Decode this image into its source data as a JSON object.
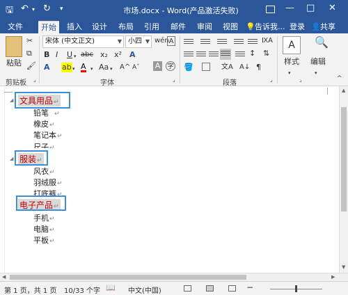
{
  "titlebar": {
    "save_icon": "save-icon",
    "undo_icon": "undo-icon",
    "redo_icon": "redo-icon",
    "title": "市场.docx - Word(产品激活失败)",
    "ribbon_display_icon": "ribbon-display-icon",
    "minimize": "—",
    "maximize": "□",
    "close": "✕"
  },
  "tabs": [
    "文件",
    "开始",
    "插入",
    "设计",
    "布局",
    "引用",
    "邮件",
    "审阅",
    "视图"
  ],
  "tell_me": "告诉我...",
  "signin": "登录",
  "share": "共享",
  "ribbon": {
    "clipboard": {
      "paste": "粘贴",
      "group": "剪贴板"
    },
    "font": {
      "name": "宋体 (中文正文)",
      "size": "小四",
      "bold": "B",
      "italic": "I",
      "underline": "U",
      "strike": "abc",
      "subscript": "x₂",
      "superscript": "x²",
      "case": "Aa",
      "group": "字体"
    },
    "paragraph": {
      "group": "段落"
    },
    "styles": {
      "label": "样式"
    },
    "editing": {
      "label": "编辑"
    }
  },
  "document": {
    "groups": [
      {
        "title": "文具用品",
        "items": [
          "铅笔",
          "橡皮",
          "笔记本",
          "尺子"
        ]
      },
      {
        "title": "服装",
        "items": [
          "风衣",
          "羽绒服",
          "打底裤"
        ]
      },
      {
        "title": "电子产品",
        "items": [
          "手机",
          "电脑",
          "平板"
        ]
      }
    ]
  },
  "status": {
    "page": "第 1 页，共 1 页",
    "words": "10/33 个字",
    "language": "中文(中国)",
    "zoom_minus": "−"
  },
  "colors": {
    "accent": "#2b579a",
    "heading_text": "#c00000",
    "highlight_box": "#3a8fd9"
  }
}
